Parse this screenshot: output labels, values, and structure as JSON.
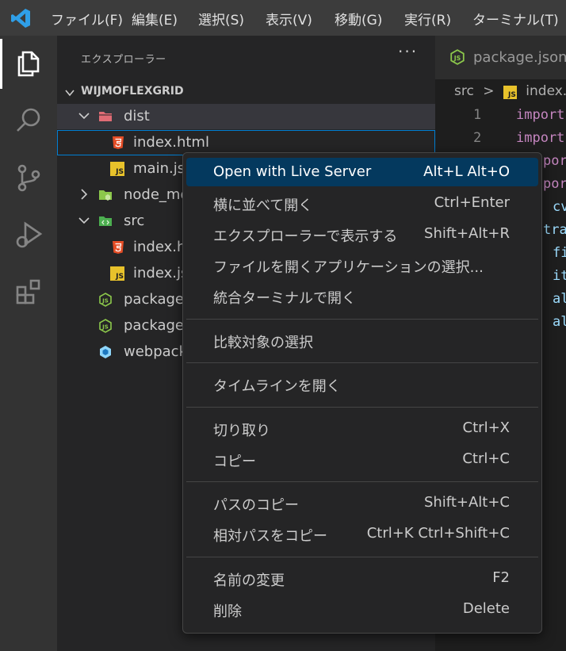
{
  "menubar": {
    "items": [
      "ファイル(F)",
      "編集(E)",
      "選択(S)",
      "表示(V)",
      "移動(G)",
      "実行(R)",
      "ターミナル(T)"
    ]
  },
  "activitybar": {
    "icons": [
      "files-icon",
      "search-icon",
      "source-control-icon",
      "run-debug-icon",
      "extensions-icon"
    ],
    "active": "files-icon"
  },
  "sidebar": {
    "title": "エクスプローラー",
    "more": "···",
    "section": "WIJMOFLEXGRID",
    "tree": [
      {
        "label": "dist",
        "icon": "folder-dist-icon"
      },
      {
        "label": "index.html",
        "icon": "html5-icon"
      },
      {
        "label": "main.js",
        "icon": "js-icon"
      },
      {
        "label": "node_mo",
        "icon": "folder-node-icon"
      },
      {
        "label": "src",
        "icon": "folder-src-icon"
      },
      {
        "label": "index.h",
        "icon": "html5-icon"
      },
      {
        "label": "index.js",
        "icon": "js-icon"
      },
      {
        "label": "package-",
        "icon": "nodejs-icon"
      },
      {
        "label": "package.",
        "icon": "nodejs-icon"
      },
      {
        "label": "webpack",
        "icon": "webpack-icon"
      }
    ]
  },
  "editor": {
    "tab_label": "package.json",
    "breadcrumb": {
      "folder": "src",
      "sep": ">",
      "file": "index.js"
    },
    "line_numbers": [
      "1",
      "2"
    ],
    "code_fragments": [
      "import",
      "import",
      "port",
      "port",
      "cv",
      "tra",
      "fi",
      "it",
      "al",
      "al"
    ]
  },
  "context_menu": {
    "groups": [
      [
        {
          "label": "Open with Live Server",
          "shortcut": "Alt+L Alt+O",
          "highlighted": true
        },
        {
          "label": "横に並べて開く",
          "shortcut": "Ctrl+Enter"
        },
        {
          "label": "エクスプローラーで表示する",
          "shortcut": "Shift+Alt+R"
        },
        {
          "label": "ファイルを開くアプリケーションの選択...",
          "shortcut": ""
        },
        {
          "label": "統合ターミナルで開く",
          "shortcut": ""
        }
      ],
      [
        {
          "label": "比較対象の選択",
          "shortcut": ""
        }
      ],
      [
        {
          "label": "タイムラインを開く",
          "shortcut": ""
        }
      ],
      [
        {
          "label": "切り取り",
          "shortcut": "Ctrl+X"
        },
        {
          "label": "コピー",
          "shortcut": "Ctrl+C"
        }
      ],
      [
        {
          "label": "パスのコピー",
          "shortcut": "Shift+Alt+C"
        },
        {
          "label": "相対パスをコピー",
          "shortcut": "Ctrl+K Ctrl+Shift+C"
        }
      ],
      [
        {
          "label": "名前の変更",
          "shortcut": "F2"
        },
        {
          "label": "削除",
          "shortcut": "Delete"
        }
      ]
    ]
  },
  "colors": {
    "accent": "#007acc",
    "menu_highlight": "#04395e",
    "html_icon": "#e44d26",
    "js_icon": "#e8c22b",
    "node_icon": "#8cc84b",
    "webpack_icon": "#8ed6fb"
  }
}
